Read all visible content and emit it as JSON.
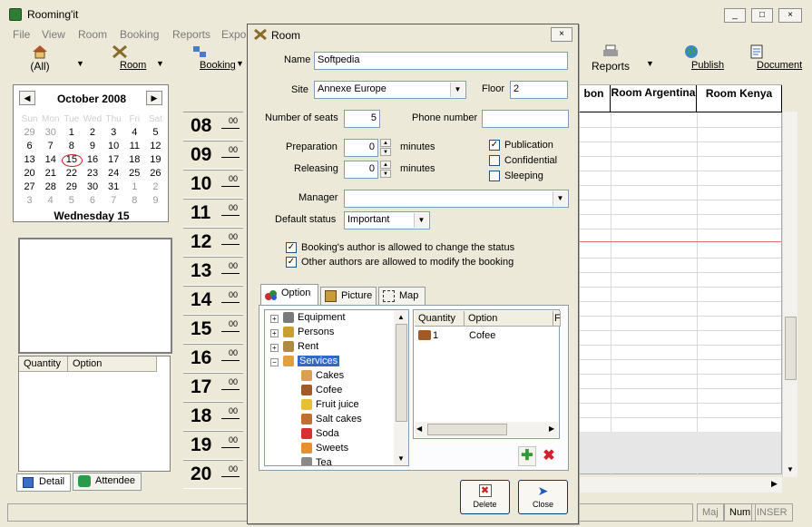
{
  "app": {
    "title": "Rooming'it"
  },
  "menu": [
    "File",
    "View",
    "Room",
    "Booking",
    "Reports",
    "Expo"
  ],
  "toolbar": {
    "all": "(All)",
    "room": "Room",
    "booking": "Booking",
    "reports": "Reports",
    "publish": "Publish",
    "document": "Document"
  },
  "calendar": {
    "month": "October 2008",
    "weekdays": [
      "Sun",
      "Mon",
      "Tue",
      "Wed",
      "Thu",
      "Fri",
      "Sat"
    ],
    "weeks": [
      [
        "29",
        "30",
        "1",
        "2",
        "3",
        "4",
        "5"
      ],
      [
        "6",
        "7",
        "8",
        "9",
        "10",
        "11",
        "12"
      ],
      [
        "13",
        "14",
        "15",
        "16",
        "17",
        "18",
        "19"
      ],
      [
        "20",
        "21",
        "22",
        "23",
        "24",
        "25",
        "26"
      ],
      [
        "27",
        "28",
        "29",
        "30",
        "31",
        "1",
        "2"
      ],
      [
        "3",
        "4",
        "5",
        "6",
        "7",
        "8",
        "9"
      ]
    ],
    "today_label": "Wednesday 15"
  },
  "left_list": {
    "col_quantity": "Quantity",
    "col_option": "Option"
  },
  "left_tabs": {
    "detail": "Detail",
    "attendee": "Attendee"
  },
  "hours": [
    "08",
    "09",
    "10",
    "11",
    "12",
    "13",
    "14",
    "15",
    "16",
    "17",
    "18",
    "19",
    "20"
  ],
  "minutes": "00",
  "rooms": {
    "partial": "bon",
    "argentina": "Room Argentina",
    "kenya": "Room Kenya"
  },
  "status": {
    "maj": "Maj",
    "num": "Num",
    "inser": "INSER"
  },
  "dialog": {
    "title": "Room",
    "name_label": "Name",
    "name_value": "Softpedia",
    "site_label": "Site",
    "site_value": "Annexe Europe",
    "floor_label": "Floor",
    "floor_value": "2",
    "seats_label": "Number of seats",
    "seats_value": "5",
    "phone_label": "Phone number",
    "phone_value": "",
    "prep_label": "Preparation",
    "prep_value": "0",
    "rel_label": "Releasing",
    "rel_value": "0",
    "minutes_unit": "minutes",
    "publication_label": "Publication",
    "publication_checked": true,
    "confidential_label": "Confidential",
    "confidential_checked": false,
    "sleeping_label": "Sleeping",
    "sleeping_checked": false,
    "manager_label": "Manager",
    "manager_value": "",
    "status_label": "Default status",
    "status_value": "Important",
    "cb_author_label": "Booking's author is allowed to change the status",
    "cb_others_label": "Other authors are allowed to modify the booking",
    "tabs": {
      "option": "Option",
      "picture": "Picture",
      "map": "Map"
    },
    "tree": [
      {
        "label": "Equipment",
        "expander": "+"
      },
      {
        "label": "Persons",
        "expander": "+"
      },
      {
        "label": "Rent",
        "expander": "+"
      },
      {
        "label": "Services",
        "expander": "−"
      },
      {
        "label": "Cakes"
      },
      {
        "label": "Cofee"
      },
      {
        "label": "Fruit juice"
      },
      {
        "label": "Salt cakes"
      },
      {
        "label": "Soda"
      },
      {
        "label": "Sweets"
      },
      {
        "label": "Tea"
      }
    ],
    "grid": {
      "col_quantity": "Quantity",
      "col_option": "Option",
      "col_extra": "F",
      "row_quantity": "1",
      "row_option": "Cofee"
    },
    "delete_label": "Delete",
    "close_label": "Close"
  },
  "colors": {
    "selection": "#316ac5",
    "today_circle": "#d32020",
    "add": "#2e9b34",
    "remove": "#d0202a"
  }
}
